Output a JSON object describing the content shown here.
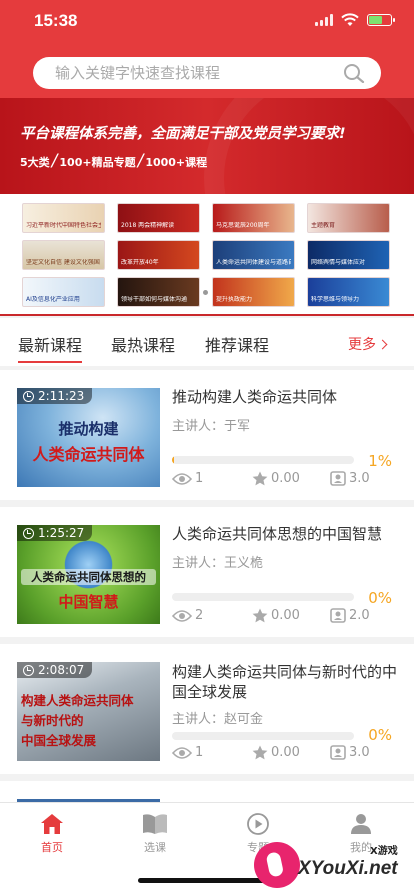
{
  "status_bar": {
    "time": "15:38"
  },
  "search": {
    "placeholder": "输入关键字快速查找课程"
  },
  "banner": {
    "title": "平台课程体系完善，全面满足干部及党员学习要求!",
    "stats": [
      "5大类",
      "100+精品专题",
      "1000+课程"
    ]
  },
  "thumbnails": [
    {
      "label": "习近平新时代中国特色社会主义思想"
    },
    {
      "label": "2018 两会精神解读"
    },
    {
      "label": "马克思诞辰200周年"
    },
    {
      "label": "主题教育"
    },
    {
      "label": "坚定文化自信 建设文化强国"
    },
    {
      "label": "改革开放40年"
    },
    {
      "label": "人类命运共同体建设与道路自信"
    },
    {
      "label": "网络舆情与媒体应对"
    },
    {
      "label": "AI及信息化产业应用"
    },
    {
      "label": "领导干部如何与媒体沟通"
    },
    {
      "label": "提升执政能力"
    },
    {
      "label": "科学思维与领导力"
    }
  ],
  "tabs": [
    "最新课程",
    "最热课程",
    "推荐课程"
  ],
  "more_label": "更多",
  "courses": [
    {
      "title": "推动构建人类命运共同体",
      "lecturer": "主讲人：于军",
      "duration": "2:11:23",
      "progress_percent": 1,
      "progress_label": "1%",
      "views": "1",
      "rating": "0.00",
      "score": "3.0",
      "cover_lines": [
        "推动构建",
        "人类命运共同体"
      ]
    },
    {
      "title": "人类命运共同体思想的中国智慧",
      "lecturer": "主讲人：王义桅",
      "duration": "1:25:27",
      "progress_percent": 0,
      "progress_label": "0%",
      "views": "2",
      "rating": "0.00",
      "score": "2.0",
      "cover_lines": [
        "人类命运共同体思想的",
        "中国智慧"
      ]
    },
    {
      "title": "构建人类命运共同体与新时代的中国全球发展",
      "lecturer": "主讲人：赵可金",
      "duration": "2:08:07",
      "progress_percent": 0,
      "progress_label": "0%",
      "views": "1",
      "rating": "0.00",
      "score": "3.0",
      "cover_lines": [
        "构建人类命运共同体",
        "与新时代的",
        "中国全球发展"
      ]
    }
  ],
  "tabbar": [
    {
      "label": "首页",
      "icon": "home-icon",
      "active": true
    },
    {
      "label": "选课",
      "icon": "book-icon",
      "active": false
    },
    {
      "label": "专题",
      "icon": "play-icon",
      "active": false
    },
    {
      "label": "我的",
      "icon": "user-icon",
      "active": false
    }
  ],
  "watermark": {
    "small": "X游戏",
    "big": "XYouXi.net"
  },
  "colors": {
    "brand_red": "#e53b3d",
    "progress_orange": "#f5a623"
  }
}
